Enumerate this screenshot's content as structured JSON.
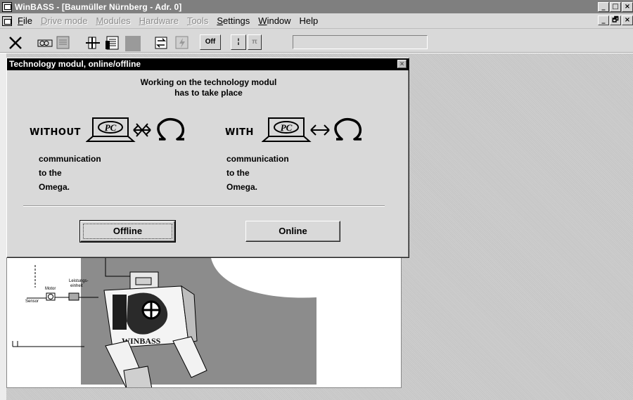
{
  "window": {
    "title": "WinBASS - [Baumüller Nürnberg - Adr. 0]",
    "min_glyph": "_",
    "max_glyph": "□",
    "close_glyph": "×",
    "restore_glyph": "🗗"
  },
  "menu": {
    "items": [
      {
        "label": "File",
        "mnemonic": "F",
        "rest": "ile",
        "enabled": true
      },
      {
        "label": "Drive mode",
        "mnemonic": "D",
        "rest": "rive mode",
        "enabled": false
      },
      {
        "label": "Modules",
        "mnemonic": "M",
        "rest": "odules",
        "enabled": false
      },
      {
        "label": "Hardware",
        "mnemonic": "H",
        "rest": "ardware",
        "enabled": false
      },
      {
        "label": "Tools",
        "mnemonic": "T",
        "rest": "ools",
        "enabled": false
      },
      {
        "label": "Settings",
        "mnemonic": "S",
        "rest": "ettings",
        "enabled": true
      },
      {
        "label": "Window",
        "mnemonic": "W",
        "rest": "indow",
        "enabled": true
      },
      {
        "label": "Help",
        "mnemonic": "",
        "rest": "Help",
        "enabled": true
      }
    ]
  },
  "toolbar": {
    "off_label": "Off",
    "stop_label": "¦",
    "pause_label": "π"
  },
  "dialog": {
    "title": "Technology modul, online/offline",
    "close_glyph": "×",
    "message_line1": "Working on the technology modul",
    "message_line2": "has to take place",
    "without_label": "WITHOUT",
    "with_label": "WITH",
    "pc_label": "PC",
    "desc_left": [
      "communication",
      "to the",
      "Omega."
    ],
    "desc_right": [
      "communication",
      "to the",
      "Omega."
    ],
    "offline_button": "Offline",
    "online_button": "Online"
  },
  "background_picture": {
    "labels": [
      "Motor",
      "Leistungs-",
      "einheit",
      "Sensor"
    ],
    "logo_text": "WINBASS"
  }
}
